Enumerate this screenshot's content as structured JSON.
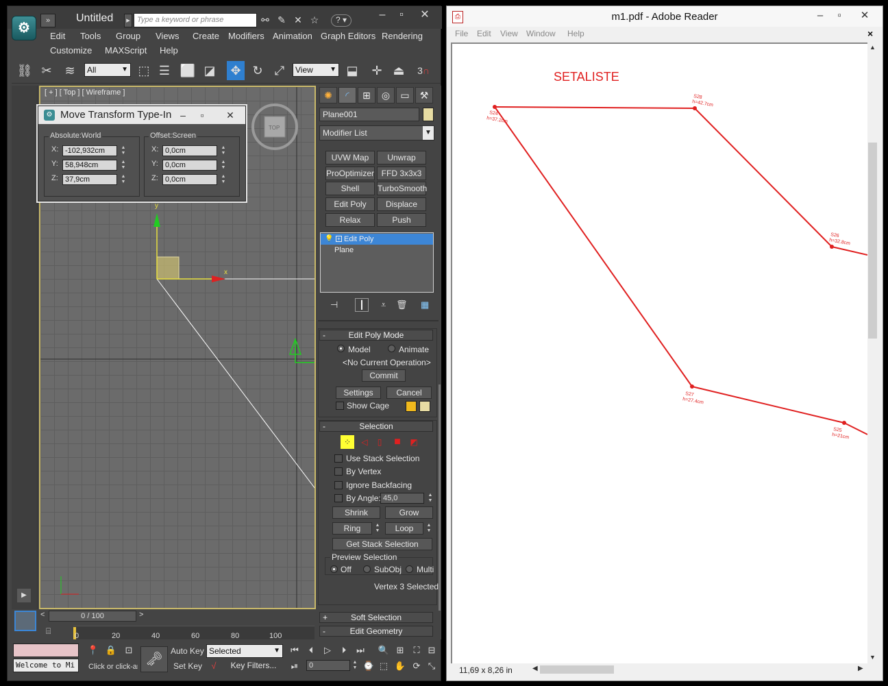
{
  "max": {
    "title": "Untitled",
    "search_placeholder": "Type a keyword or phrase",
    "help_icon": "?",
    "menu": [
      "Edit",
      "Tools",
      "Group",
      "Views",
      "Create",
      "Modifiers",
      "Animation",
      "Graph Editors",
      "Rendering",
      "Customize",
      "MAXScript",
      "Help"
    ],
    "toolbar": {
      "selection_filter": "All",
      "ref_coord": "View",
      "snap_number": "3"
    },
    "viewport": {
      "label": "[ + ] [ Top ] [ Wireframe ]",
      "viewcube_label": "TOP",
      "axis_y": "y",
      "axis_x": "x"
    },
    "move_dialog": {
      "title": "Move Transform Type-In",
      "absolute_title": "Absolute:World",
      "offset_title": "Offset:Screen",
      "absolute": {
        "x": "-102,932cm",
        "y": "58,948cm",
        "z": "37,9cm"
      },
      "offset": {
        "x": "0,0cm",
        "y": "0,0cm",
        "z": "0,0cm"
      },
      "labels": {
        "x": "X:",
        "y": "Y:",
        "z": "Z:"
      }
    },
    "command_panel": {
      "object_name": "Plane001",
      "object_color": "#e7dca3",
      "modifier_list": "Modifier List",
      "modifier_buttons": [
        "UVW Map",
        "Unwrap UVW",
        "ProOptimizer",
        "FFD 3x3x3",
        "Shell",
        "TurboSmooth",
        "Edit Poly",
        "Displace",
        "Relax",
        "Push"
      ],
      "stack": {
        "item1": "Edit Poly",
        "item2": "Plane"
      },
      "edit_poly_mode": {
        "title": "Edit Poly Mode",
        "model": "Model",
        "animate": "Animate",
        "operation": "<No Current Operation>",
        "commit": "Commit",
        "settings": "Settings",
        "cancel": "Cancel",
        "show_cage": "Show Cage"
      },
      "selection": {
        "title": "Selection",
        "use_stack": "Use Stack Selection",
        "by_vertex": "By Vertex",
        "ignore_backfacing": "Ignore Backfacing",
        "by_angle": "By Angle:",
        "angle_value": "45,0",
        "shrink": "Shrink",
        "grow": "Grow",
        "ring": "Ring",
        "loop": "Loop",
        "get_stack": "Get Stack Selection",
        "preview_title": "Preview Selection",
        "off": "Off",
        "subobj": "SubObj",
        "multi": "Multi",
        "status": "Vertex 3 Selected"
      },
      "soft_selection": "Soft Selection",
      "edit_geometry": "Edit Geometry"
    },
    "timeline": {
      "slider": "0 / 100",
      "ticks": [
        "0",
        "20",
        "40",
        "60",
        "80",
        "100"
      ]
    },
    "status": {
      "maxscript": "Welcome to Mi",
      "prompt": "Click or click-an",
      "auto_key": "Auto Key",
      "set_key": "Set Key",
      "selected": "Selected",
      "key_filters": "Key Filters...",
      "frame": "0"
    }
  },
  "reader": {
    "title": "m1.pdf - Adobe Reader",
    "menu": [
      "File",
      "Edit",
      "View",
      "Window",
      "Help"
    ],
    "close_doc": "×",
    "page_size": "11,69 x 8,26 in",
    "drawing": {
      "heading": "SETALISTE",
      "line_color": "#e02020",
      "points": [
        {
          "name": "S24",
          "h": "h=37.2cm"
        },
        {
          "name": "S28",
          "h": "h=42.7cm"
        },
        {
          "name": "S26",
          "h": "h=32.8cm"
        },
        {
          "name": "S27",
          "h": "h=27.4cm"
        },
        {
          "name": "S25",
          "h": "h=21cm"
        }
      ]
    }
  }
}
